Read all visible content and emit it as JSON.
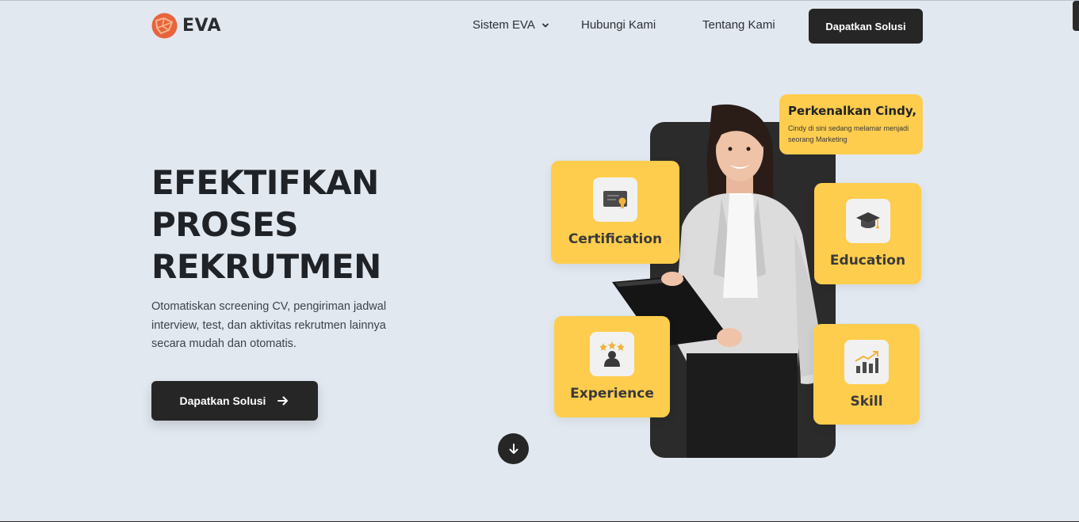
{
  "brand": {
    "name": "EVA",
    "accent": "#e8643a"
  },
  "nav": {
    "items": [
      {
        "label": "Sistem EVA",
        "icon": "chevron-down-icon"
      },
      {
        "label": "Hubungi Kami"
      },
      {
        "label": "Tentang Kami"
      }
    ],
    "cta_label": "Dapatkan Solusi"
  },
  "hero": {
    "title_lines": [
      "EFEKTIFKAN",
      "PROSES",
      "REKRUTMEN"
    ],
    "description": "Otomatiskan screening CV, pengiriman jadwal interview, test, dan aktivitas rekrutmen lainnya secara mudah dan otomatis.",
    "cta_label": "Dapatkan Solusi"
  },
  "profile": {
    "intro_title": "Perkenalkan Cindy,",
    "intro_sub": "Cindy di sini sedang melamar menjadi seorang Marketing",
    "cards": [
      {
        "label": "Certification",
        "icon": "certificate-icon"
      },
      {
        "label": "Education",
        "icon": "graduation-cap-icon"
      },
      {
        "label": "Experience",
        "icon": "star-person-icon"
      },
      {
        "label": "Skill",
        "icon": "growth-chart-icon"
      }
    ]
  },
  "colors": {
    "card": "#ffcd4d",
    "dark": "#262626",
    "background": "#e2e8f0"
  }
}
